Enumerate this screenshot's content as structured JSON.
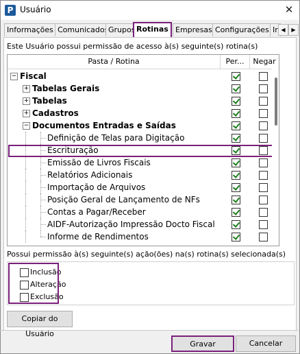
{
  "window": {
    "title": "Usuário",
    "icon": "app-p-icon"
  },
  "tabs": [
    {
      "label": "Informações",
      "active": false
    },
    {
      "label": "Comunicados",
      "active": false
    },
    {
      "label": "Grupos",
      "active": false
    },
    {
      "label": "Rotinas",
      "active": true
    },
    {
      "label": "Empresas",
      "active": false
    },
    {
      "label": "Configurações",
      "active": false
    },
    {
      "label": "Ir",
      "active": false
    }
  ],
  "info_text": "Este Usuário possui permissão de acesso à(s) seguinte(s) rotina(s)",
  "tree": {
    "headers": {
      "folder": "Pasta / Rotina",
      "permit": "Per...",
      "deny": "Negar"
    },
    "rows": [
      {
        "label": "Fiscal",
        "bold": true,
        "level": 0,
        "expander": "−",
        "permit": true,
        "deny": false
      },
      {
        "label": "Tabelas Gerais",
        "bold": true,
        "level": 1,
        "expander": "+",
        "permit": true,
        "deny": false
      },
      {
        "label": "Tabelas",
        "bold": true,
        "level": 1,
        "expander": "+",
        "permit": true,
        "deny": false
      },
      {
        "label": "Cadastros",
        "bold": true,
        "level": 1,
        "expander": "+",
        "permit": true,
        "deny": false
      },
      {
        "label": "Documentos Entradas e Saídas",
        "bold": true,
        "level": 1,
        "expander": "−",
        "permit": true,
        "deny": false
      },
      {
        "label": "Definição de Telas para Digitação",
        "bold": false,
        "level": 2,
        "expander": "",
        "permit": true,
        "deny": false
      },
      {
        "label": "Escrituração",
        "bold": false,
        "level": 2,
        "expander": "",
        "permit": true,
        "deny": false
      },
      {
        "label": "Emissão de Livros Fiscais",
        "bold": false,
        "level": 2,
        "expander": "",
        "permit": true,
        "deny": false
      },
      {
        "label": "Relatórios Adicionais",
        "bold": false,
        "level": 2,
        "expander": "",
        "permit": true,
        "deny": false
      },
      {
        "label": "Importação de Arquivos",
        "bold": false,
        "level": 2,
        "expander": "",
        "permit": true,
        "deny": false
      },
      {
        "label": "Posição Geral de Lançamento de NFs",
        "bold": false,
        "level": 2,
        "expander": "",
        "permit": true,
        "deny": false
      },
      {
        "label": "Contas a Pagar/Receber",
        "bold": false,
        "level": 2,
        "expander": "",
        "permit": true,
        "deny": false
      },
      {
        "label": "AIDF-Autorização Impressão Docto Fiscal",
        "bold": false,
        "level": 2,
        "expander": "",
        "permit": true,
        "deny": false
      },
      {
        "label": "Informe de Rendimentos",
        "bold": false,
        "level": 2,
        "expander": "",
        "permit": true,
        "deny": false
      }
    ]
  },
  "actions_text": "Possui permissão à(s) seguinte(s) ação(ões) na(s) rotina(s) selecionada(s)",
  "actions": [
    {
      "label": "Inclusão",
      "checked": false
    },
    {
      "label": "Alteração",
      "checked": false
    },
    {
      "label": "Exclusão",
      "checked": false
    }
  ],
  "buttons": {
    "copy": "Copiar do Usuário",
    "save": "Gravar",
    "cancel": "Cancelar"
  },
  "colors": {
    "highlight": "#7a1f7a",
    "check": "#1a7f1a"
  }
}
